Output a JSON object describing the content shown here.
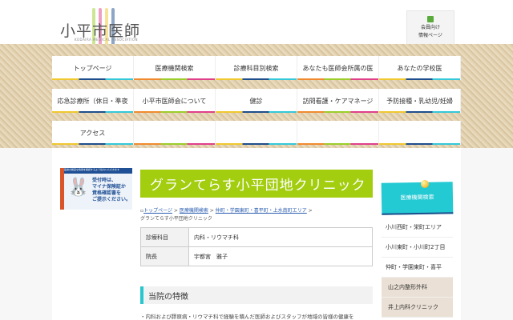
{
  "header": {
    "logo_text": "小平市医師会",
    "logo_sub": "KODAIRA MEDICAL ASSOCIATION",
    "member_line1": "会員向け",
    "member_line2": "情報ページ"
  },
  "nav": [
    [
      "トップページ",
      "医療機関検索",
      "診療科目別検索",
      "あなたも医師会所属の医",
      "あなたの学校医"
    ],
    [
      "応急診療所（休日・準夜",
      "小平市医師会について",
      "健診",
      "訪問看護・ケアマネージ",
      "予防接種・乳幼児/妊婦"
    ],
    [
      "アクセス",
      "",
      "",
      "",
      ""
    ]
  ],
  "banner": {
    "top": "医療の確実な情報を確認するよう協力いただきます",
    "line1": "受付時は、",
    "line2": "マイナ保険証か",
    "line3": "資格確認書を",
    "line4": "ご提示ください。"
  },
  "page": {
    "title": "グランてらす小平団地クリニック",
    "breadcrumb": [
      "トップページ",
      "医療機関検索",
      "仲町・学園東町・喜平町・上水南町エリア"
    ],
    "breadcrumb_current": "グランてらす小平団地クリニック",
    "sep": ">",
    "table": [
      {
        "label": "診療科目",
        "value": "内科・リウマチ科"
      },
      {
        "label": "院長",
        "value": "宇都宮　雅子"
      }
    ],
    "section": "当院の特徴",
    "body": "・内科および膠原病・リウマチ科で経験を積んだ医師およびスタッフが地域の皆様の健康を"
  },
  "sidebar": {
    "header": "医療機関検索",
    "items": [
      "小川西町・栄町エリア",
      "小川東町・小川町2丁目",
      "仲町・学園東町・喜平",
      "山之内整形外科",
      "井上内科クリニック"
    ]
  }
}
